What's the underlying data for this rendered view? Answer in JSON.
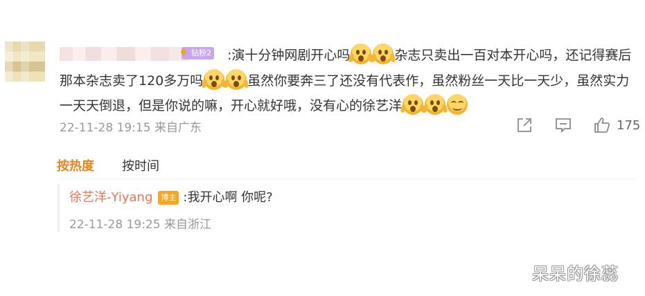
{
  "comment": {
    "fan_badge": "钻粉2",
    "segments": [
      ":演十分钟网剧开心吗",
      "杂志只卖出一百对本开心吗，还记得赛后那本杂志卖了120多万吗",
      "虽然你要奔三了还没有代表作，虽然粉丝一天比一天少，虽然实力一天天倒退，但是你说的嘛，开心就好哦，没有心的徐艺洋"
    ],
    "time": "22-11-28 19:15",
    "location": "来自广东",
    "likes": "175"
  },
  "icons": {
    "share": "share-icon",
    "comment": "comment-icon",
    "like": "thumbs-up-icon",
    "emoji_shock": "shocked-face-emoji",
    "emoji_smile": "smile-face-emoji"
  },
  "sort_tabs": {
    "hot": "按热度",
    "time": "按时间"
  },
  "reply": {
    "name": "徐艺洋-Yiyang",
    "badge": "博主",
    "text": ":我开心啊 你呢?",
    "time": "22-11-28 19:25",
    "location": "来自浙江"
  },
  "watermark": "呆呆的徐蕊",
  "colors": {
    "accent_orange": "#e8841f",
    "reply_name": "#eb7350",
    "meta_gray": "#999999"
  }
}
